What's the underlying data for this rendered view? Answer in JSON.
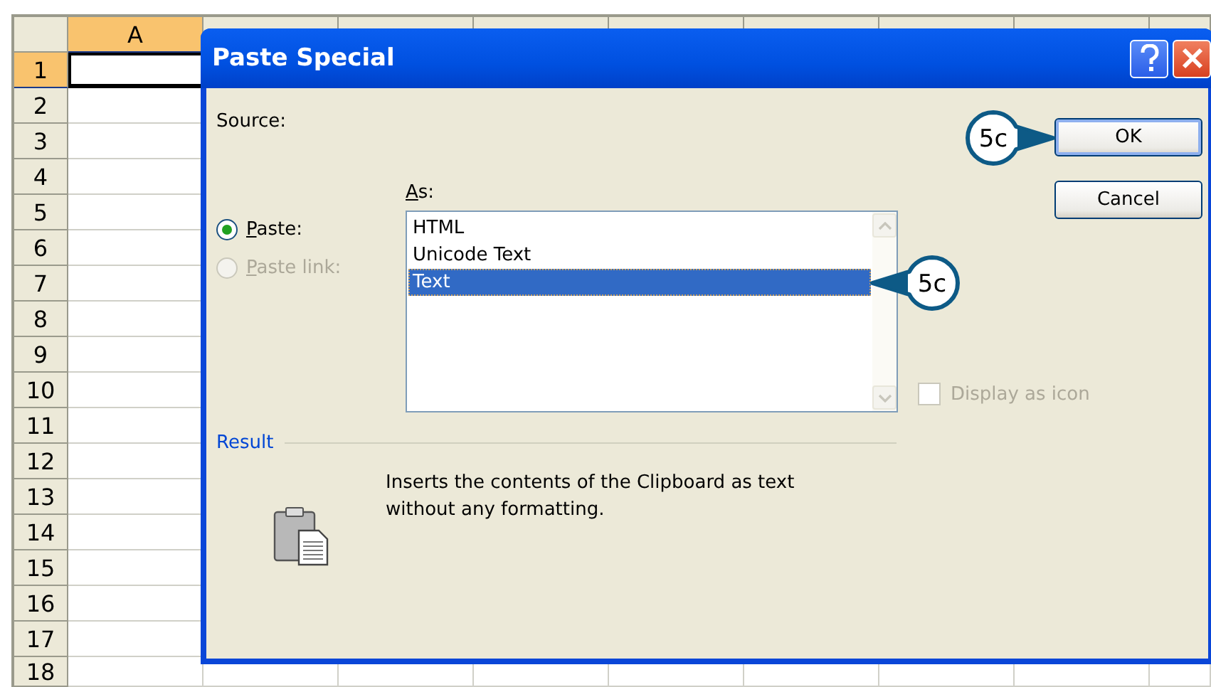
{
  "sheet": {
    "columns": [
      {
        "label": "A",
        "selected": true
      }
    ],
    "rows": [
      {
        "label": "1",
        "selected": true
      },
      {
        "label": "2",
        "selected": false
      },
      {
        "label": "3",
        "selected": false
      },
      {
        "label": "4",
        "selected": false
      },
      {
        "label": "5",
        "selected": false
      },
      {
        "label": "6",
        "selected": false
      },
      {
        "label": "7",
        "selected": false
      },
      {
        "label": "8",
        "selected": false
      },
      {
        "label": "9",
        "selected": false
      },
      {
        "label": "10",
        "selected": false
      },
      {
        "label": "11",
        "selected": false
      },
      {
        "label": "12",
        "selected": false
      },
      {
        "label": "13",
        "selected": false
      },
      {
        "label": "14",
        "selected": false
      },
      {
        "label": "15",
        "selected": false
      },
      {
        "label": "16",
        "selected": false
      },
      {
        "label": "17",
        "selected": false
      },
      {
        "label": "18",
        "selected": false
      }
    ]
  },
  "dialog": {
    "title": "Paste Special",
    "source_label": "Source:",
    "as_label": "As:",
    "radios": [
      {
        "label": "Paste:",
        "selected": true,
        "disabled": false
      },
      {
        "label": "Paste link:",
        "selected": false,
        "disabled": true
      }
    ],
    "list": [
      {
        "label": "HTML",
        "selected": false
      },
      {
        "label": "Unicode Text",
        "selected": false
      },
      {
        "label": "Text",
        "selected": true
      }
    ],
    "checkbox": {
      "label": "Display as icon",
      "checked": false,
      "disabled": true
    },
    "result": {
      "label": "Result",
      "description": "Inserts the contents of the Clipboard as text without any formatting."
    },
    "buttons": [
      {
        "label": "OK",
        "default": true
      },
      {
        "label": "Cancel",
        "default": false
      }
    ]
  },
  "callouts": [
    {
      "label": "5c",
      "kind": "right"
    },
    {
      "label": "5c",
      "kind": "left"
    }
  ]
}
